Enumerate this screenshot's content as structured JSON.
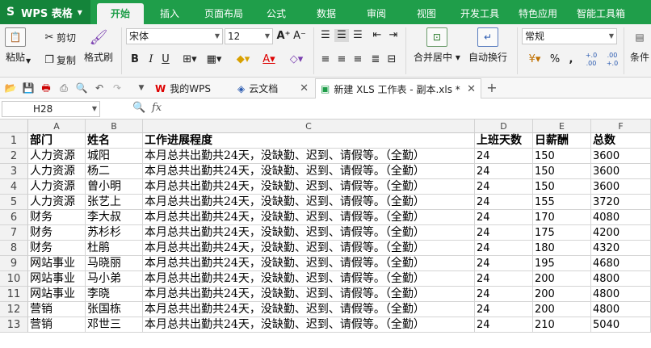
{
  "app": {
    "brand": "WPS 表格",
    "tabs": [
      "开始",
      "插入",
      "页面布局",
      "公式",
      "数据",
      "审阅",
      "视图",
      "开发工具",
      "特色应用",
      "智能工具箱"
    ],
    "active_tab": "开始"
  },
  "ribbon": {
    "paste": "粘贴",
    "cut": "剪切",
    "copy": "复制",
    "format_painter": "格式刷",
    "font_name": "宋体",
    "font_size": "12",
    "merge_center": "合并居中",
    "wrap_text": "自动换行",
    "number_format": "常规",
    "percent": "%",
    "thousands": ",",
    "inc_decimal": "+.0 .00",
    "dec_decimal": ".00 +.0",
    "conditions": "条件"
  },
  "doc_tabs": [
    {
      "label": "我的WPS",
      "icon": "wps-icon"
    },
    {
      "label": "云文档",
      "icon": "cloud-doc-icon"
    },
    {
      "label": "新建 XLS 工作表 - 副本.xls *",
      "icon": "sheet-icon"
    }
  ],
  "formula_bar": {
    "cell_ref": "H28",
    "fx": "fx",
    "formula": ""
  },
  "sheet": {
    "columns": [
      "A",
      "B",
      "C",
      "D",
      "E",
      "F"
    ],
    "row_numbers": [
      "1",
      "2",
      "3",
      "4",
      "5",
      "6",
      "7",
      "8",
      "9",
      "10",
      "11",
      "12",
      "13"
    ],
    "header": [
      "部门",
      "姓名",
      "工作进展程度",
      "上班天数",
      "日薪酬",
      "总数"
    ],
    "rows": [
      [
        "人力资源",
        "城阳",
        "本月总共出勤共24天，没缺勤、迟到、请假等。（全勤）",
        "24",
        "150",
        "3600"
      ],
      [
        "人力资源",
        "杨二",
        "本月总共出勤共24天，没缺勤、迟到、请假等。（全勤）",
        "24",
        "150",
        "3600"
      ],
      [
        "人力资源",
        "曾小明",
        "本月总共出勤共24天，没缺勤、迟到、请假等。（全勤）",
        "24",
        "150",
        "3600"
      ],
      [
        "人力资源",
        "张艺上",
        "本月总共出勤共24天，没缺勤、迟到、请假等。（全勤）",
        "24",
        "155",
        "3720"
      ],
      [
        "财务",
        "李大叔",
        "本月总共出勤共24天，没缺勤、迟到、请假等。（全勤）",
        "24",
        "170",
        "4080"
      ],
      [
        "财务",
        "苏杉杉",
        "本月总共出勤共24天，没缺勤、迟到、请假等。（全勤）",
        "24",
        "175",
        "4200"
      ],
      [
        "财务",
        "杜鹃",
        "本月总共出勤共24天，没缺勤、迟到、请假等。（全勤）",
        "24",
        "180",
        "4320"
      ],
      [
        "网站事业",
        "马晓丽",
        "本月总共出勤共24天，没缺勤、迟到、请假等。（全勤）",
        "24",
        "195",
        "4680"
      ],
      [
        "网站事业",
        "马小弟",
        "本月总共出勤共24天，没缺勤、迟到、请假等。（全勤）",
        "24",
        "200",
        "4800"
      ],
      [
        "网站事业",
        "李晓",
        "本月总共出勤共24天，没缺勤、迟到、请假等。（全勤）",
        "24",
        "200",
        "4800"
      ],
      [
        "营销",
        "张国栋",
        "本月总共出勤共24天，没缺勤、迟到、请假等。（全勤）",
        "24",
        "200",
        "4800"
      ],
      [
        "营销",
        "邓世三",
        "本月总共出勤共24天，没缺勤、迟到、请假等。（全勤）",
        "24",
        "210",
        "5040"
      ]
    ]
  }
}
